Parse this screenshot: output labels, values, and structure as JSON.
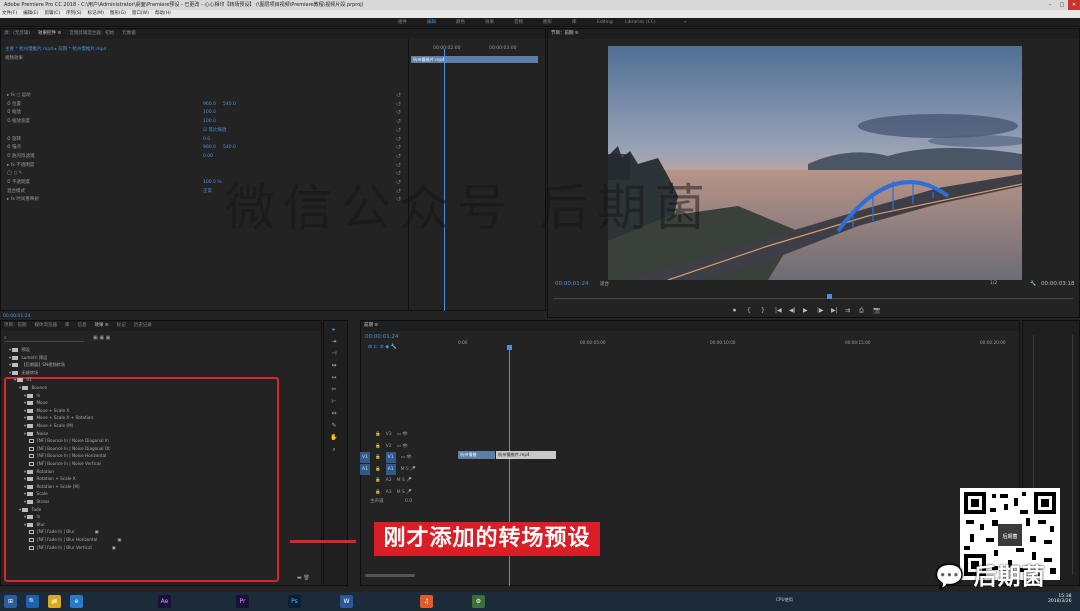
{
  "window": {
    "title": "Adobe Premiere Pro CC 2018 - C:\\用户\\Administrator\\桌面\\Premiere预设 - 已更改 - 心心相印【转场预设】 (\\图层项目视频\\Premiere教程\\视频片段.prproj)",
    "controls": [
      "–",
      "□",
      "✕"
    ]
  },
  "menu": [
    "文件(F)",
    "编辑(E)",
    "剪辑(C)",
    "序列(S)",
    "标记(M)",
    "图形(G)",
    "窗口(W)",
    "帮助(H)"
  ],
  "workspaces": [
    "组件",
    "编辑",
    "颜色",
    "效果",
    "音频",
    "图形",
    "库",
    "Editing",
    "Libraries (CC)",
    "»"
  ],
  "effect_controls": {
    "tabs": [
      "源：(无剪辑)",
      "效果控件 ≡",
      "音频剪辑混合器：初始",
      "元数据"
    ],
    "clip_header": "主要 * 杭州慢推片.mp4  ▸  前期 * 杭州慢推片.mp4",
    "section": "视频效果",
    "rows": [
      {
        "label": "▸ fx ◻ 运动",
        "v1": "",
        "v2": ""
      },
      {
        "label": "  ⏱ 位置",
        "v1": "960.0",
        "v2": "540.0"
      },
      {
        "label": "  ⏱ 缩放",
        "v1": "100.0",
        "v2": ""
      },
      {
        "label": "  ⏱ 缩放宽度",
        "v1": "100.0",
        "v2": ""
      },
      {
        "label": "",
        "v1": "☑ 等比缩放",
        "v2": ""
      },
      {
        "label": "  ⏱ 旋转",
        "v1": "0.0",
        "v2": ""
      },
      {
        "label": "  ⏱ 锚点",
        "v1": "960.0",
        "v2": "540.0"
      },
      {
        "label": "  ⏱ 防闪烁滤镜",
        "v1": "0.00",
        "v2": ""
      },
      {
        "label": "▸ fx 不透明度",
        "v1": "",
        "v2": ""
      },
      {
        "label": "  ◯ ◻ ✎",
        "v1": "",
        "v2": ""
      },
      {
        "label": "  ⏱ 不透明度",
        "v1": "100.0 %",
        "v2": ""
      },
      {
        "label": "    混合模式",
        "v1": "正常",
        "v2": ""
      },
      {
        "label": "▸ fx 时间重映射",
        "v1": "",
        "v2": ""
      }
    ],
    "mini_tc_left": "00:00:02:00",
    "mini_tc_right": "00:00:03:00",
    "mini_clip": "杭州慢推片.mp4",
    "footer_tc": "00:00:01:24"
  },
  "watermark": "微信公众号 后期菌",
  "program": {
    "title": "节目：前期 ≡",
    "timecode": "00:00:01:24",
    "fit": "适合",
    "quality": "1/2",
    "duration": "00:00:03:18",
    "controls": [
      "⏺",
      "{",
      "}",
      "|◀",
      "◀|",
      "▶",
      "|▶",
      "▶|",
      "⇉",
      "⎙",
      "📷"
    ]
  },
  "project": {
    "tabs": [
      "项目：前期",
      "媒体浏览器",
      "库",
      "信息",
      "效果 ≡",
      "标记",
      "历史记录"
    ],
    "search_placeholder": "⌕",
    "tree": [
      {
        "indent": 1,
        "type": "folder",
        "label": "预设"
      },
      {
        "indent": 1,
        "type": "folder",
        "label": "Lumetri 预设"
      },
      {
        "indent": 1,
        "type": "folder",
        "label": "【后期菌】SN视频转场"
      },
      {
        "indent": 1,
        "type": "folder",
        "label": "无缝转场"
      },
      {
        "indent": 2,
        "type": "folder",
        "label": "01"
      },
      {
        "indent": 3,
        "type": "folder",
        "label": "Bounce"
      },
      {
        "indent": 4,
        "type": "folder",
        "label": "In"
      },
      {
        "indent": 4,
        "type": "folder",
        "label": "Move"
      },
      {
        "indent": 4,
        "type": "folder",
        "label": "Move + Scale X"
      },
      {
        "indent": 4,
        "type": "folder",
        "label": "Move + Scale X + Rotation"
      },
      {
        "indent": 4,
        "type": "folder",
        "label": "Move + Scale (M)"
      },
      {
        "indent": 4,
        "type": "folder",
        "label": "Noise"
      },
      {
        "indent": 5,
        "type": "fx",
        "label": "[NF] Bounce In | Noise Diagonal In"
      },
      {
        "indent": 5,
        "type": "fx",
        "label": "[NF] Bounce In | Noise Diagonal Ot"
      },
      {
        "indent": 5,
        "type": "fx",
        "label": "[NF] Bounce In | Noise Horizontal"
      },
      {
        "indent": 5,
        "type": "fx",
        "label": "[NF] Bounce In | Noise Vertical"
      },
      {
        "indent": 4,
        "type": "folder",
        "label": "Rotation"
      },
      {
        "indent": 4,
        "type": "folder",
        "label": "Rotation + Scale X"
      },
      {
        "indent": 4,
        "type": "folder",
        "label": "Rotation + Scale (M)"
      },
      {
        "indent": 4,
        "type": "folder",
        "label": "Scale"
      },
      {
        "indent": 4,
        "type": "folder",
        "label": "Stress"
      },
      {
        "indent": 3,
        "type": "folder",
        "label": "Fade"
      },
      {
        "indent": 4,
        "type": "folder",
        "label": "In"
      },
      {
        "indent": 4,
        "type": "folder",
        "label": "Blur"
      },
      {
        "indent": 5,
        "type": "fx",
        "label": "[NF] Fade In | Blur"
      },
      {
        "indent": 5,
        "type": "fx",
        "label": "[NF] Fade In | Blur Horizontal"
      },
      {
        "indent": 5,
        "type": "fx",
        "label": "[NF] Fade In | Blur Vertical"
      }
    ]
  },
  "timeline": {
    "tab": "前期 ≡",
    "timecode": "00:00:01:24",
    "ruler": [
      "0:00",
      "00:00:05:00",
      "00:00:10:00",
      "00:00:15:00",
      "00:00:20:00"
    ],
    "tracks": [
      {
        "name": "V3",
        "side": ""
      },
      {
        "name": "V2",
        "side": ""
      },
      {
        "name": "V1",
        "side": "V1"
      },
      {
        "name": "A1",
        "side": "A1"
      },
      {
        "name": "A2",
        "side": ""
      },
      {
        "name": "A3",
        "side": ""
      }
    ],
    "master": "主声道",
    "master_val": "0.0",
    "clip_a": "杭州慢推",
    "clip_b": "杭州慢推片.mp4"
  },
  "annotation": "刚才添加的转场预设",
  "brand": "后期菌",
  "taskbar": {
    "icons": [
      "⊞",
      "🔍",
      "📁",
      "e",
      "Ae",
      "Pr",
      "Ps",
      "W",
      "♫",
      "⚙"
    ],
    "cpu": "CPU使用",
    "time": "15:38",
    "date": "2018/3/26"
  },
  "colors": {
    "accent": "#4a90e2",
    "annotation": "#d91e26"
  }
}
